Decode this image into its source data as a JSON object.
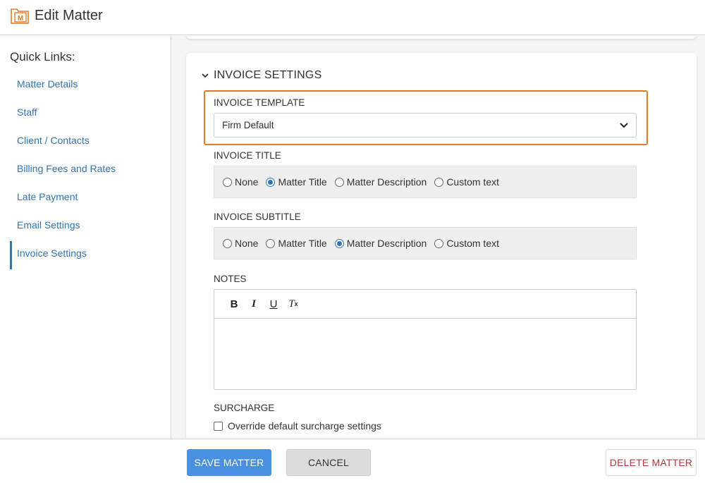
{
  "header": {
    "title": "Edit Matter",
    "icon": "matter-folder-icon",
    "icon_letter": "M"
  },
  "sidebar": {
    "title": "Quick Links:",
    "items": [
      {
        "label": "Matter Details"
      },
      {
        "label": "Staff"
      },
      {
        "label": "Client / Contacts"
      },
      {
        "label": "Billing Fees and Rates"
      },
      {
        "label": "Late Payment"
      },
      {
        "label": "Email Settings"
      },
      {
        "label": "Invoice Settings",
        "active": true
      }
    ]
  },
  "section": {
    "title": "INVOICE SETTINGS",
    "invoice_template": {
      "label": "INVOICE TEMPLATE",
      "value": "Firm Default"
    },
    "invoice_title": {
      "label": "INVOICE TITLE",
      "options": [
        "None",
        "Matter Title",
        "Matter Description",
        "Custom text"
      ],
      "selected": "Matter Title"
    },
    "invoice_subtitle": {
      "label": "INVOICE SUBTITLE",
      "options": [
        "None",
        "Matter Title",
        "Matter Description",
        "Custom text"
      ],
      "selected": "Matter Description"
    },
    "notes": {
      "label": "NOTES",
      "toolbar": [
        "B",
        "I",
        "U",
        "T"
      ]
    },
    "surcharge": {
      "label": "SURCHARGE",
      "checkbox_label": "Override default surcharge settings",
      "checked": false
    }
  },
  "footer": {
    "save_label": "SAVE MATTER",
    "cancel_label": "CANCEL",
    "delete_label": "DELETE MATTER"
  },
  "colors": {
    "accent": "#4a90e2",
    "link": "#2f75b5",
    "highlight": "#e07b2a",
    "danger": "#b03a3a"
  }
}
